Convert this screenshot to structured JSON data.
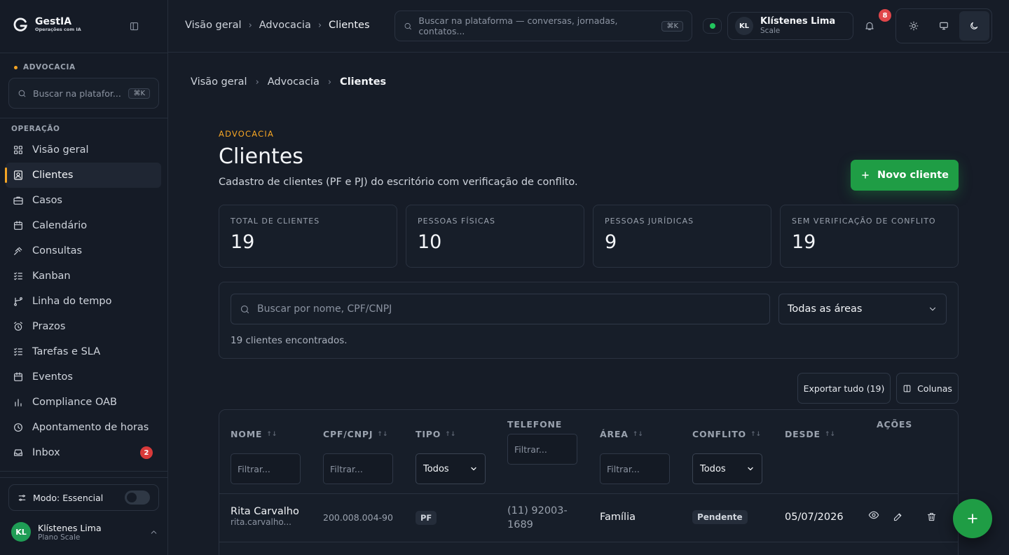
{
  "brand": {
    "name": "GestIA",
    "tagline": "Operações com IA"
  },
  "sidebar": {
    "workspace": "ADVOCACIA",
    "search": {
      "placeholder": "Buscar na platafor...",
      "shortcut": "⌘K"
    },
    "section_label": "OPERAÇÃO",
    "items": [
      {
        "label": "Visão geral",
        "icon": "grid-icon"
      },
      {
        "label": "Clientes",
        "icon": "contact-icon",
        "active": true
      },
      {
        "label": "Casos",
        "icon": "briefcase-icon"
      },
      {
        "label": "Calendário",
        "icon": "calendar-icon"
      },
      {
        "label": "Consultas",
        "icon": "gavel-icon"
      },
      {
        "label": "Kanban",
        "icon": "checklist-icon"
      },
      {
        "label": "Linha do tempo",
        "icon": "branch-icon"
      },
      {
        "label": "Prazos",
        "icon": "alarm-icon"
      },
      {
        "label": "Tarefas e SLA",
        "icon": "checklist-icon"
      },
      {
        "label": "Eventos",
        "icon": "calendar-icon"
      },
      {
        "label": "Compliance OAB",
        "icon": "bar-chart-icon"
      },
      {
        "label": "Apontamento de horas",
        "icon": "clock-icon"
      },
      {
        "label": "Inbox",
        "icon": "inbox-icon",
        "badge": "2"
      }
    ],
    "mode_label": "Modo: Essencial",
    "user": {
      "initials": "KL",
      "name": "Klístenes Lima",
      "plan": "Plano Scale"
    }
  },
  "topbar": {
    "breadcrumb": [
      "Visão geral",
      "Advocacia",
      "Clientes"
    ],
    "search_placeholder": "Buscar na plataforma — conversas, jornadas, contatos...",
    "search_shortcut": "⌘K",
    "user": {
      "initials": "KL",
      "name": "Klístenes Lima",
      "plan": "Scale"
    },
    "notifications": "8"
  },
  "page": {
    "breadcrumb": [
      "Visão geral",
      "Advocacia",
      "Clientes"
    ],
    "eyebrow": "ADVOCACIA",
    "title": "Clientes",
    "description": "Cadastro de clientes (PF e PJ) do escritório com verificação de conflito.",
    "new_button": "Novo cliente"
  },
  "stats": [
    {
      "label": "TOTAL DE CLIENTES",
      "value": "19"
    },
    {
      "label": "PESSOAS FÍSICAS",
      "value": "10"
    },
    {
      "label": "PESSOAS JURÍDICAS",
      "value": "9"
    },
    {
      "label": "SEM VERIFICAÇÃO DE CONFLITO",
      "value": "19"
    }
  ],
  "filters": {
    "search_placeholder": "Buscar por nome, CPF/CNPJ",
    "area_selected": "Todas as áreas",
    "results_text": "19 clientes encontrados."
  },
  "toolbar": {
    "export_label": "Exportar tudo (19)",
    "columns_label": "Colunas"
  },
  "table": {
    "columns": [
      "NOME",
      "CPF/CNPJ",
      "TIPO",
      "TELEFONE",
      "ÁREA",
      "CONFLITO",
      "DESDE",
      "AÇÕES"
    ],
    "filter_placeholder": "Filtrar...",
    "select_all": "Todos",
    "rows": [
      {
        "name": "Rita Carvalho",
        "email": "rita.carvalho...",
        "doc": "200.008.004-90",
        "type": "PF",
        "phone_line1": "(11) 92003-",
        "phone_line2": "1689",
        "area": "Família",
        "conflict": "Pendente",
        "since": "05/07/2026"
      }
    ]
  },
  "colors": {
    "accent": "#f5a524",
    "primary": "#1f9d45",
    "badge": "#d83a3a",
    "background": "#161c27"
  }
}
